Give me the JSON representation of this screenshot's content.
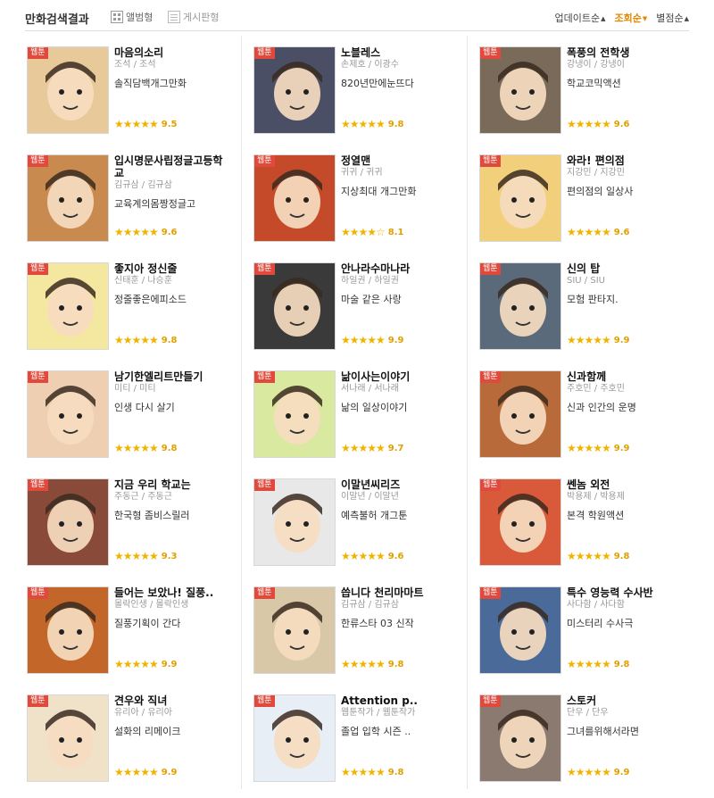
{
  "header": {
    "title": "만화검색결과",
    "view_album": "앨범형",
    "view_board": "게시판형",
    "sort_update": "업데이트순",
    "sort_views": "조회순",
    "sort_rating": "별점순"
  },
  "badge_label": "웹툰",
  "cards": [
    {
      "title": "마음의소리",
      "author": "조석 / 조석",
      "desc": "솔직담백개그만화",
      "score": "9.5",
      "stars": "★★★★★"
    },
    {
      "title": "노블레스",
      "author": "손제호 / 이광수",
      "desc": "820년만에눈뜨다",
      "score": "9.8",
      "stars": "★★★★★"
    },
    {
      "title": "폭풍의 전학생",
      "author": "강냉이 / 강냉이",
      "desc": "학교코믹액션",
      "score": "9.6",
      "stars": "★★★★★"
    },
    {
      "title": "입시명문사립정글고등학교",
      "author": "김규삼 / 김규삼",
      "desc": "교육계의몸짱정글고",
      "score": "9.6",
      "stars": "★★★★★"
    },
    {
      "title": "정열맨",
      "author": "귀귀 / 귀귀",
      "desc": "지상최대 개그만화",
      "score": "8.1",
      "stars": "★★★★☆"
    },
    {
      "title": "와라! 편의점",
      "author": "지강민 / 지강민",
      "desc": "편의점의 일상사",
      "score": "9.6",
      "stars": "★★★★★"
    },
    {
      "title": "좋지아 정신줄",
      "author": "신태훈 / 나승훈",
      "desc": "정줄좋은에피소드",
      "score": "9.8",
      "stars": "★★★★★"
    },
    {
      "title": "안나라수마나라",
      "author": "하일권 / 하일권",
      "desc": "마술 같은 사랑",
      "score": "9.9",
      "stars": "★★★★★"
    },
    {
      "title": "신의 탑",
      "author": "SIU / SIU",
      "desc": "모험 판타지.",
      "score": "9.9",
      "stars": "★★★★★"
    },
    {
      "title": "남기한엘리트만들기",
      "author": "미티 / 미티",
      "desc": "인생 다시 살기",
      "score": "9.8",
      "stars": "★★★★★"
    },
    {
      "title": "낢이사는이야기",
      "author": "서나래 / 서나래",
      "desc": "낢의 일상이야기",
      "score": "9.7",
      "stars": "★★★★★"
    },
    {
      "title": "신과함께",
      "author": "주호민 / 주호민",
      "desc": "신과 인간의 운명",
      "score": "9.9",
      "stars": "★★★★★"
    },
    {
      "title": "지금 우리 학교는",
      "author": "주동근 / 주동근",
      "desc": "한국형 좀비스릴러",
      "score": "9.3",
      "stars": "★★★★★"
    },
    {
      "title": "이말년씨리즈",
      "author": "이말년 / 이말년",
      "desc": "예측불허 개그툰",
      "score": "9.6",
      "stars": "★★★★★"
    },
    {
      "title": "쎈놈 외전",
      "author": "박용제 / 박용제",
      "desc": "본격 학원액션",
      "score": "9.8",
      "stars": "★★★★★"
    },
    {
      "title": "들어는 보았나! 질풍..",
      "author": "몰락인생 / 몰락인생",
      "desc": "질풍기획이 간다",
      "score": "9.9",
      "stars": "★★★★★"
    },
    {
      "title": "씁니다 천리마마트",
      "author": "김규삼 / 김규삼",
      "desc": "한류스타 03 신작",
      "score": "9.8",
      "stars": "★★★★★"
    },
    {
      "title": "특수 영능력 수사반",
      "author": "사다함 / 사다함",
      "desc": "미스터리 수사극",
      "score": "9.8",
      "stars": "★★★★★"
    },
    {
      "title": "견우와 직녀",
      "author": "유리아 / 유리아",
      "desc": "설화의 리메이크",
      "score": "9.9",
      "stars": "★★★★★"
    },
    {
      "title": "Attention p..",
      "author": "웹툰작가 / 웹툰작가",
      "desc": "졸업 입학 시즌 ..",
      "score": "9.8",
      "stars": "★★★★★"
    },
    {
      "title": "스토커",
      "author": "단우 / 단우",
      "desc": "그녀를위해서라면",
      "score": "9.9",
      "stars": "★★★★★"
    }
  ],
  "thumb_colors": [
    "#e8c99a",
    "#4a4f66",
    "#7a6a5a",
    "#c98a50",
    "#c44a2a",
    "#f2cf7a",
    "#f4e7a0",
    "#3a3a3a",
    "#5a6a7a",
    "#efcfb2",
    "#d9e9a0",
    "#b86a3a",
    "#8a4a3a",
    "#e8e8e8",
    "#d95a3a",
    "#c2662a",
    "#d8c8a8",
    "#4a6a9a",
    "#f0e2c8",
    "#e8eef5",
    "#8a7a70"
  ],
  "no_rating_star": "☆"
}
